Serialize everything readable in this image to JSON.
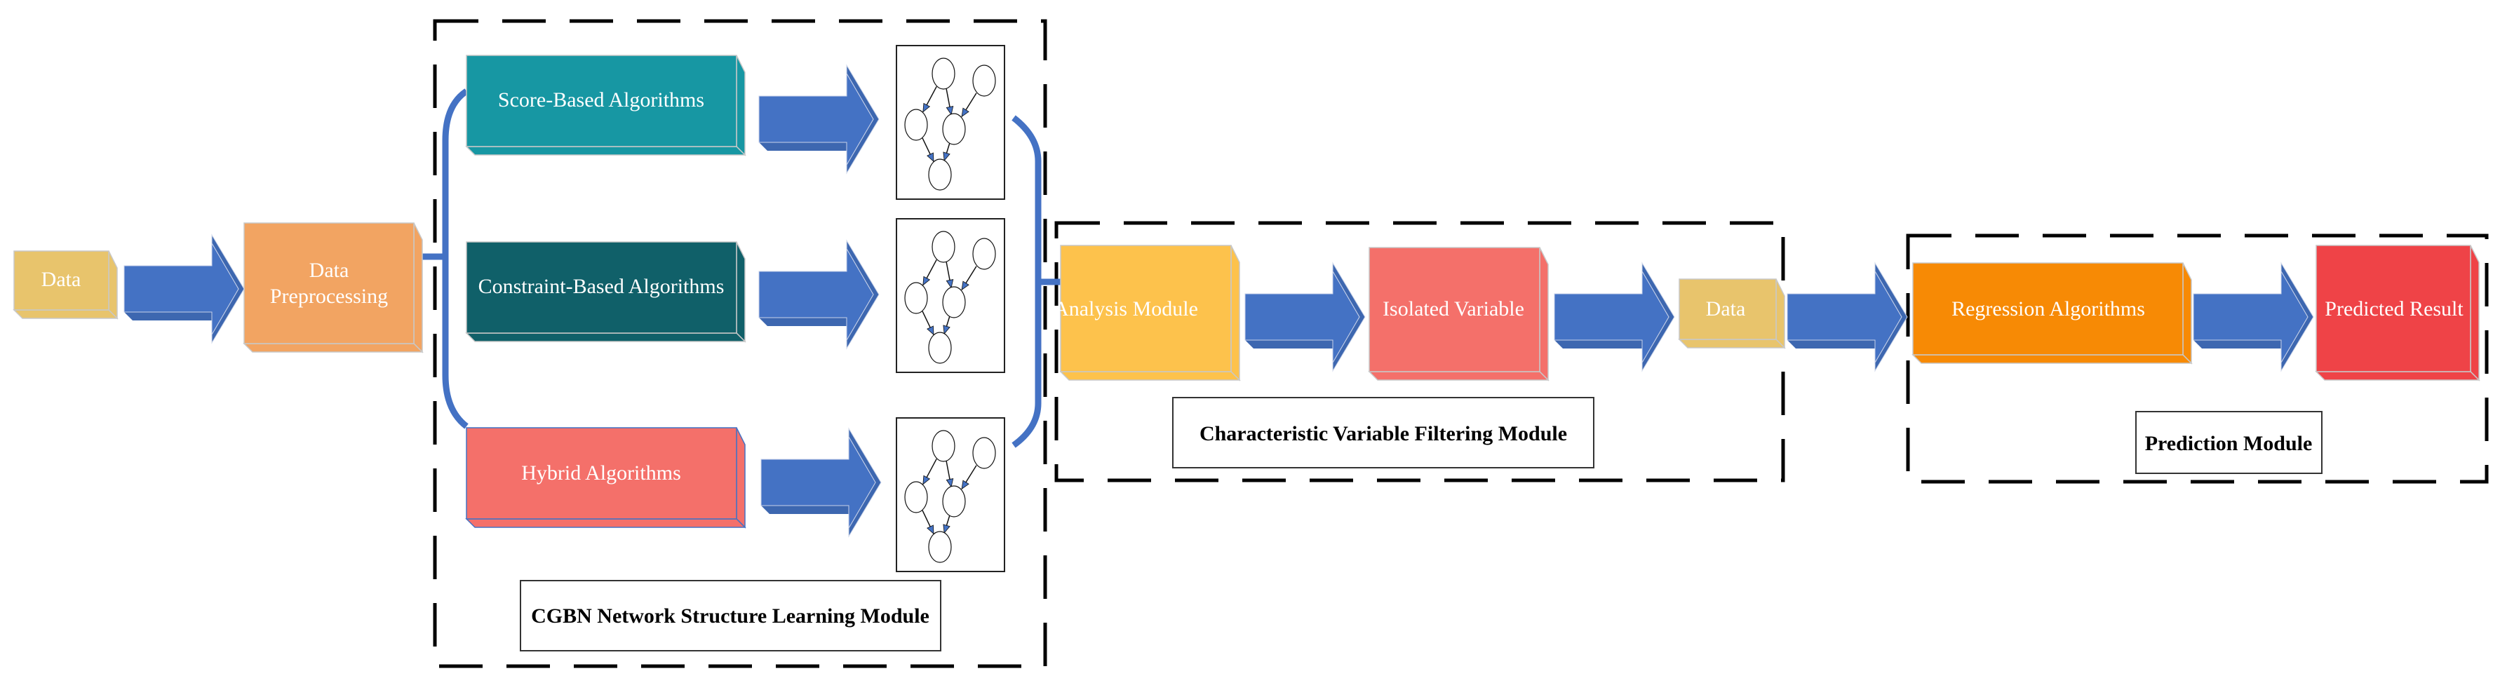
{
  "diagram": {
    "colors": {
      "arrow": "#4472C4",
      "connector": "#4472C4",
      "data": "#E8C46C",
      "preprocessing": "#F2A462",
      "score_based": "#1797A3",
      "constraint_based": "#106069",
      "hybrid": "#F4706A",
      "analysis": "#FDC24C",
      "isolated": "#F4706A",
      "regression": "#F78A05",
      "predicted": "#EF4347",
      "label_box_border": "#333333",
      "module_border": "#000000"
    },
    "nodes": {
      "data_input": {
        "label": "Data"
      },
      "preprocessing": {
        "label_line1": "Data",
        "label_line2": "Preprocessing"
      },
      "score_based": {
        "label": "Score-Based Algorithms"
      },
      "constraint_based": {
        "label": "Constraint-Based Algorithms"
      },
      "hybrid": {
        "label": "Hybrid Algorithms"
      },
      "analysis": {
        "label": "Analysis Module"
      },
      "isolated": {
        "label": "Isolated Variable"
      },
      "data_filtered": {
        "label": "Data"
      },
      "regression": {
        "label": "Regression Algorithms"
      },
      "predicted": {
        "label": "Predicted Result"
      }
    },
    "modules": {
      "structure_learning": {
        "label": "CGBN Network Structure Learning Module"
      },
      "variable_filtering": {
        "label": "Characteristic Variable Filtering Module"
      },
      "prediction": {
        "label": "Prediction Module"
      }
    },
    "network_graph": {
      "nodes": 5,
      "edges": [
        [
          "A",
          "C"
        ],
        [
          "A",
          "D"
        ],
        [
          "B",
          "D"
        ],
        [
          "C",
          "E"
        ],
        [
          "D",
          "E"
        ]
      ]
    }
  }
}
